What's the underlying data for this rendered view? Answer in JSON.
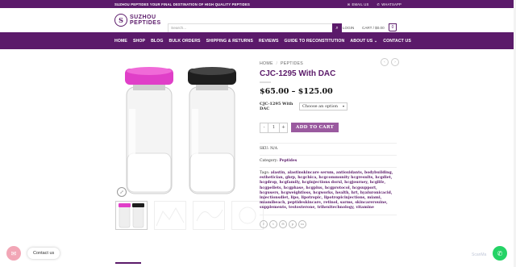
{
  "topbar": {
    "tagline": "SUZHOU PEPTIDES YOUR FINAL DESTINATION OF HIGH QUALITY PEPTIDES",
    "email_label": "EMAIL US",
    "whatsapp_label": "WHATSAPP"
  },
  "header": {
    "logo_line1": "SUZHOU",
    "logo_line2": "PEPTIDES",
    "search_placeholder": "Search...",
    "login_label": "LOGIN",
    "cart_label": "CART / $0.00",
    "cart_count": "0"
  },
  "nav": {
    "items": [
      "HOME",
      "SHOP",
      "BLOG",
      "BULK ORDERS",
      "SHIPPING & RETURNS",
      "REVIEWS",
      "GUIDE TO RECONSTITUTION",
      "ABOUT US ⌄",
      "CONTACT US"
    ]
  },
  "product": {
    "breadcrumb_home": "HOME",
    "breadcrumb_sep": "/",
    "breadcrumb_cat": "PEPTIDES",
    "title": "CJC-1295 With DAC",
    "price_range": "$65.00 – $125.00",
    "option_label": "CJC-1295 With DAC",
    "option_placeholder": "Choose an option",
    "qty_minus": "-",
    "qty_value": "1",
    "qty_plus": "+",
    "add_to_cart": "ADD TO CART",
    "sku_label": "SKU:",
    "sku_value": "N/A",
    "category_label": "Category:",
    "category_value": "Peptides",
    "tags_label": "Tags:",
    "tags_value": "alastin, alastinskincare serum, antioxidants, bodybuilding, esthetician, ghrp, hcgchica, hcgcommunity hcgresults, hcgdiet, hcgdrop, hcgfamily, hcginjections dorxl, hcgjourney, hcglife, hcgpellets, hcgphase, hcgplus, hcgprotocol, hcgsupport, hcgusers, hcgweightloss, hcgworks, health, hrt, hyaluronicacid, injectionsdiet, lipo, lipotropic, lipotropicinjections, miami, miamibeach, peptideskincare, retinol, sarms, skincarerouine, supplements, testosterone, trihexitechnology, vitamine"
  },
  "share_icons": [
    "facebook-icon",
    "twitter-icon",
    "email-icon",
    "pinterest-icon",
    "linkedin-icon"
  ],
  "widgets": {
    "contact_label": "Contact us",
    "scan_label": "ScanMa"
  },
  "colors": {
    "brand": "#5b1a6a",
    "button": "#9a5a9f",
    "whatsapp": "#25d366"
  }
}
